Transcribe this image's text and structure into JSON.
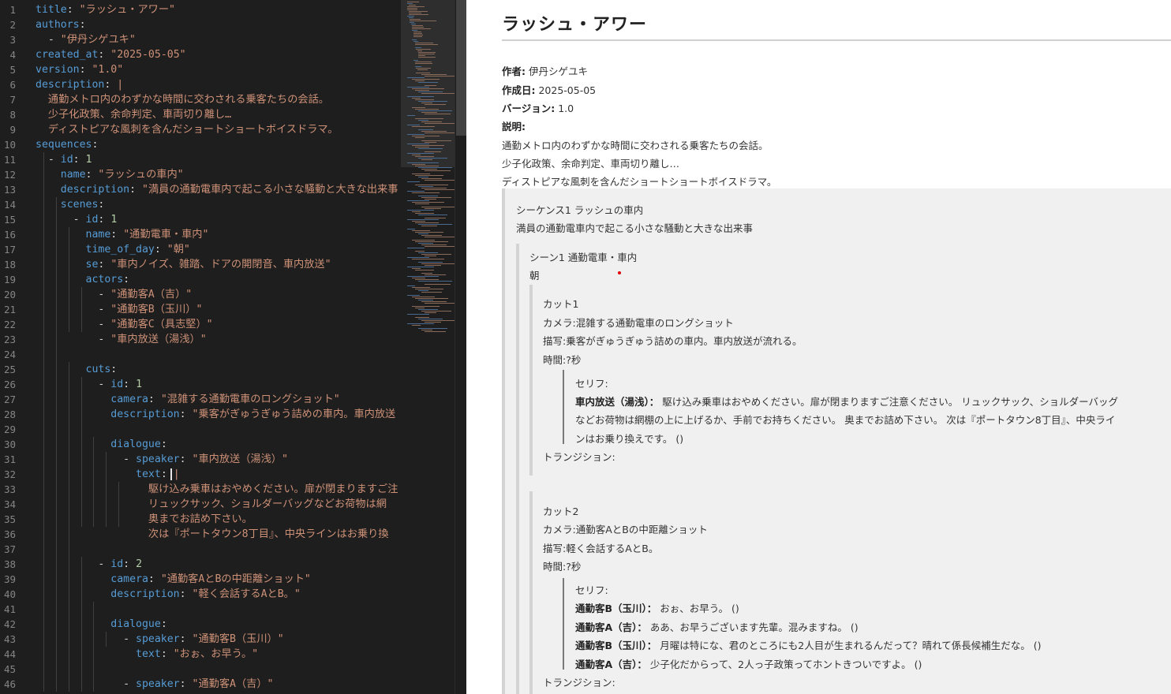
{
  "editor": {
    "lines": [
      [
        [
          "k",
          "title"
        ],
        [
          "p",
          ": "
        ],
        [
          "s",
          "\"ラッシュ・アワー\""
        ]
      ],
      [
        [
          "k",
          "authors"
        ],
        [
          "p",
          ":"
        ]
      ],
      [
        [
          "p",
          "  - "
        ],
        [
          "s",
          "\"伊丹シゲユキ\""
        ]
      ],
      [
        [
          "k",
          "created_at"
        ],
        [
          "p",
          ": "
        ],
        [
          "s",
          "\"2025-05-05\""
        ]
      ],
      [
        [
          "k",
          "version"
        ],
        [
          "p",
          ": "
        ],
        [
          "s",
          "\"1.0\""
        ]
      ],
      [
        [
          "k",
          "description"
        ],
        [
          "p",
          ": "
        ],
        [
          "s",
          "|"
        ]
      ],
      [
        [
          "s",
          "  通勤メトロ内のわずかな時間に交わされる乗客たちの会話。"
        ]
      ],
      [
        [
          "s",
          "  少子化政策、余命判定、車両切り離し…"
        ]
      ],
      [
        [
          "s",
          "  ディストピアな風刺を含んだショートショートボイスドラマ。"
        ]
      ],
      [
        [
          "k",
          "sequences"
        ],
        [
          "p",
          ":"
        ]
      ],
      [
        [
          "p",
          "  - "
        ],
        [
          "k",
          "id"
        ],
        [
          "p",
          ": "
        ],
        [
          "n",
          "1"
        ]
      ],
      [
        [
          "p",
          "    "
        ],
        [
          "k",
          "name"
        ],
        [
          "p",
          ": "
        ],
        [
          "s",
          "\"ラッシュの車内\""
        ]
      ],
      [
        [
          "p",
          "    "
        ],
        [
          "k",
          "description"
        ],
        [
          "p",
          ": "
        ],
        [
          "s",
          "\"満員の通勤電車内で起こる小さな騒動と大きな出来事"
        ]
      ],
      [
        [
          "p",
          "    "
        ],
        [
          "k",
          "scenes"
        ],
        [
          "p",
          ":"
        ]
      ],
      [
        [
          "p",
          "      - "
        ],
        [
          "k",
          "id"
        ],
        [
          "p",
          ": "
        ],
        [
          "n",
          "1"
        ]
      ],
      [
        [
          "p",
          "        "
        ],
        [
          "k",
          "name"
        ],
        [
          "p",
          ": "
        ],
        [
          "s",
          "\"通勤電車・車内\""
        ]
      ],
      [
        [
          "p",
          "        "
        ],
        [
          "k",
          "time_of_day"
        ],
        [
          "p",
          ": "
        ],
        [
          "s",
          "\"朝\""
        ]
      ],
      [
        [
          "p",
          "        "
        ],
        [
          "k",
          "se"
        ],
        [
          "p",
          ": "
        ],
        [
          "s",
          "\"車内ノイズ、雑踏、ドアの開閉音、車内放送\""
        ]
      ],
      [
        [
          "p",
          "        "
        ],
        [
          "k",
          "actors"
        ],
        [
          "p",
          ":"
        ]
      ],
      [
        [
          "p",
          "          - "
        ],
        [
          "s",
          "\"通勤客A（吉）\""
        ]
      ],
      [
        [
          "p",
          "          - "
        ],
        [
          "s",
          "\"通勤客B（玉川）\""
        ]
      ],
      [
        [
          "p",
          "          - "
        ],
        [
          "s",
          "\"通勤客C（具志堅）\""
        ]
      ],
      [
        [
          "p",
          "          - "
        ],
        [
          "s",
          "\"車内放送（湯浅）\""
        ]
      ],
      [],
      [
        [
          "p",
          "        "
        ],
        [
          "k",
          "cuts"
        ],
        [
          "p",
          ":"
        ]
      ],
      [
        [
          "p",
          "          - "
        ],
        [
          "k",
          "id"
        ],
        [
          "p",
          ": "
        ],
        [
          "n",
          "1"
        ]
      ],
      [
        [
          "p",
          "            "
        ],
        [
          "k",
          "camera"
        ],
        [
          "p",
          ": "
        ],
        [
          "s",
          "\"混雑する通勤電車のロングショット\""
        ]
      ],
      [
        [
          "p",
          "            "
        ],
        [
          "k",
          "description"
        ],
        [
          "p",
          ": "
        ],
        [
          "s",
          "\"乗客がぎゅうぎゅう詰めの車内。車内放送"
        ]
      ],
      [],
      [
        [
          "p",
          "            "
        ],
        [
          "k",
          "dialogue"
        ],
        [
          "p",
          ":"
        ]
      ],
      [
        [
          "p",
          "              - "
        ],
        [
          "k",
          "speaker"
        ],
        [
          "p",
          ": "
        ],
        [
          "s",
          "\"車内放送（湯浅）\""
        ]
      ],
      [
        [
          "p",
          "                "
        ],
        [
          "k",
          "text"
        ],
        [
          "p",
          ": "
        ],
        [
          "s",
          "|"
        ]
      ],
      [
        [
          "s",
          "                  駆け込み乗車はおやめください。扉が閉まりますご注"
        ]
      ],
      [
        [
          "s",
          "                  リュックサック、ショルダーバッグなどお荷物は網"
        ]
      ],
      [
        [
          "s",
          "                  奥までお詰め下さい。"
        ]
      ],
      [
        [
          "s",
          "                  次は『ポートタウン8丁目』、中央ラインはお乗り換"
        ]
      ],
      [],
      [
        [
          "p",
          "          - "
        ],
        [
          "k",
          "id"
        ],
        [
          "p",
          ": "
        ],
        [
          "n",
          "2"
        ]
      ],
      [
        [
          "p",
          "            "
        ],
        [
          "k",
          "camera"
        ],
        [
          "p",
          ": "
        ],
        [
          "s",
          "\"通勤客AとBの中距離ショット\""
        ]
      ],
      [
        [
          "p",
          "            "
        ],
        [
          "k",
          "description"
        ],
        [
          "p",
          ": "
        ],
        [
          "s",
          "\"軽く会話するAとB。\""
        ]
      ],
      [],
      [
        [
          "p",
          "            "
        ],
        [
          "k",
          "dialogue"
        ],
        [
          "p",
          ":"
        ]
      ],
      [
        [
          "p",
          "              - "
        ],
        [
          "k",
          "speaker"
        ],
        [
          "p",
          ": "
        ],
        [
          "s",
          "\"通勤客B（玉川）\""
        ]
      ],
      [
        [
          "p",
          "                "
        ],
        [
          "k",
          "text"
        ],
        [
          "p",
          ": "
        ],
        [
          "s",
          "\"おぉ、お早う。\""
        ]
      ],
      [],
      [
        [
          "p",
          "              - "
        ],
        [
          "k",
          "speaker"
        ],
        [
          "p",
          ": "
        ],
        [
          "s",
          "\"通勤客A（吉）\""
        ]
      ]
    ]
  },
  "preview": {
    "title": "ラッシュ・アワー",
    "meta": {
      "author_label": "作者:",
      "author": "伊丹シゲユキ",
      "created_label": "作成日:",
      "created": "2025-05-05",
      "version_label": "バージョン:",
      "version": "1.0",
      "description_label": "説明:",
      "description_lines": [
        "通勤メトロ内のわずかな時間に交わされる乗客たちの会話。",
        "少子化政策、余命判定、車両切り離し…",
        "ディストピアな風刺を含んだショートショートボイスドラマ。"
      ]
    },
    "sequence": {
      "heading": "シーケンス1 ラッシュの車内",
      "description": "満員の通勤電車内で起こる小さな騒動と大きな出来事",
      "scene": {
        "heading": "シーン1 通勤電車・車内",
        "time_of_day": "朝",
        "cuts": [
          {
            "heading": "カット1",
            "camera": "カメラ:混雑する通勤電車のロングショット",
            "description": "描写:乗客がぎゅうぎゅう詰めの車内。車内放送が流れる。",
            "time": "時間:?秒",
            "dialogue_label": "セリフ:",
            "dialogue": [
              {
                "speaker": "車内放送（湯浅）：",
                "lines": [
                  "駆け込み乗車はおやめください。扉が閉まりますご注意ください。 リュックサック、ショルダーバッグ",
                  "などお荷物は網棚の上に上げるか、手前でお持ちください。 奥までお詰め下さい。 次は『ポートタウン8丁目』、中央ライ",
                  "ンはお乗り換えです。 ()"
                ]
              }
            ],
            "transition": "トランジション:"
          },
          {
            "heading": "カット2",
            "camera": "カメラ:通勤客AとBの中距離ショット",
            "description": "描写:軽く会話するAとB。",
            "time": "時間:?秒",
            "dialogue_label": "セリフ:",
            "dialogue": [
              {
                "speaker": "通勤客B（玉川）：",
                "text": "おぉ、お早う。 ()"
              },
              {
                "speaker": "通勤客A（吉）：",
                "text": "ああ、お早うございます先輩。混みますね。 ()"
              },
              {
                "speaker": "通勤客B（玉川）：",
                "text": "月曜は特にな、君のところにも2人目が生まれるんだって？晴れて係長候補生だな。 ()"
              },
              {
                "speaker": "通勤客A（吉）：",
                "text": "少子化だからって、2人っ子政策ってホントきついですよ。 ()"
              }
            ],
            "transition": "トランジション:"
          }
        ]
      }
    }
  }
}
